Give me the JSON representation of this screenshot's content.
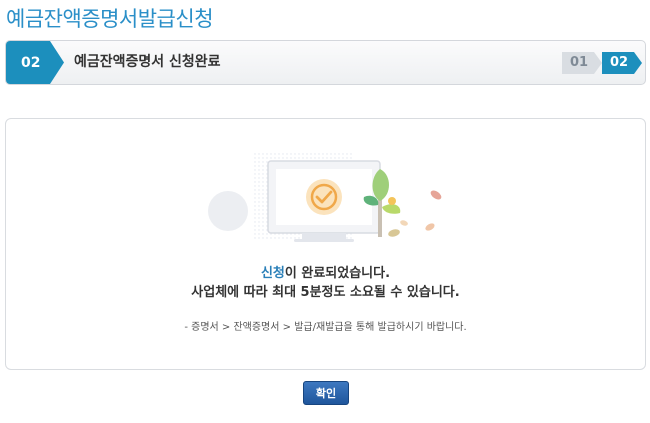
{
  "page": {
    "title": "예금잔액증명서발급신청"
  },
  "steps": {
    "current_number": "02",
    "current_label": "예금잔액증명서 신청완료",
    "indicators": [
      "01",
      "02"
    ]
  },
  "result": {
    "message_accent": "신청",
    "message_rest": "이 완료되었습니다.",
    "message_line2": "사업체에 따라 최대 5분정도 소요될 수 있습니다.",
    "path_note": "- 증명서 > 잔액증명서 > 발급/재발급을 통해 발급하시기 바랍니다."
  },
  "actions": {
    "confirm_label": "확인"
  },
  "colors": {
    "accent": "#1c8fbd",
    "button": "#2b65ad",
    "title": "#2a8fc8"
  },
  "icons": [
    "check-circle-icon",
    "monitor-icon",
    "tree-icon",
    "leaf-icon"
  ]
}
